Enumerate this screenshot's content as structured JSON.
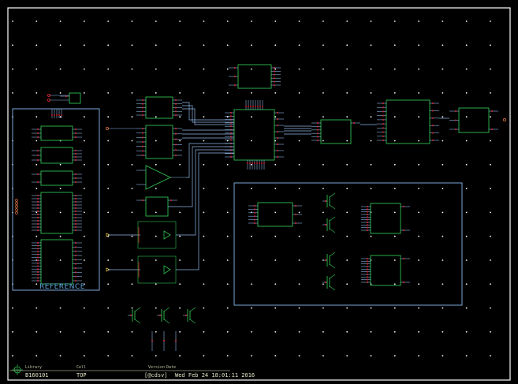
{
  "schematic": {
    "reference_label": "REFERENCE"
  },
  "title_block": {
    "library_label": "Library",
    "cell_label": "Cell",
    "version_label": "Version",
    "date_label": "Date",
    "library_value": "B160101",
    "cell_value": "TOP",
    "version_value": "[@cdsv]",
    "date_value": "Wed Feb 24 18:01:11 2016"
  },
  "colors": {
    "background": "#000000",
    "frame": "#ffffff",
    "symbol": "#2fbf4f",
    "pin": "#e0202a",
    "wire": "#8fb6e6",
    "grid": "#ffffff"
  }
}
